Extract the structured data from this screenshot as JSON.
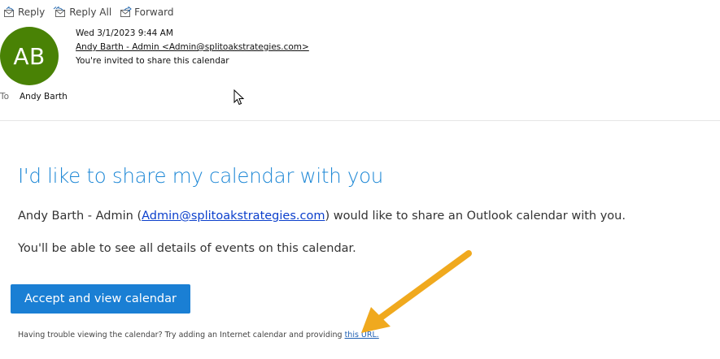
{
  "toolbar": {
    "reply_label": "Reply",
    "reply_all_label": "Reply All",
    "forward_label": "Forward"
  },
  "message": {
    "avatar_initials": "AB",
    "avatar_color": "#498205",
    "date": "Wed 3/1/2023 9:44 AM",
    "sender": "Andy Barth - Admin <Admin@splitoakstrategies.com>",
    "subject": "You're invited to share this calendar",
    "to_label": "To",
    "to_name": "Andy Barth"
  },
  "body": {
    "heading": "I'd like to share my calendar with you",
    "intro_prefix": "Andy Barth - Admin (",
    "intro_email": "Admin@splitoakstrategies.com",
    "intro_suffix": ") would like to share an Outlook calendar with you.",
    "details_text": "You'll be able to see all details of events on this calendar.",
    "accept_button_label": "Accept and view calendar",
    "trouble_text": "Having trouble viewing the calendar? Try adding an Internet calendar and providing ",
    "trouble_link": "this URL."
  },
  "colors": {
    "accent": "#1a7fd4",
    "heading": "#1e88d6",
    "annotation_arrow": "#f0a91e"
  }
}
